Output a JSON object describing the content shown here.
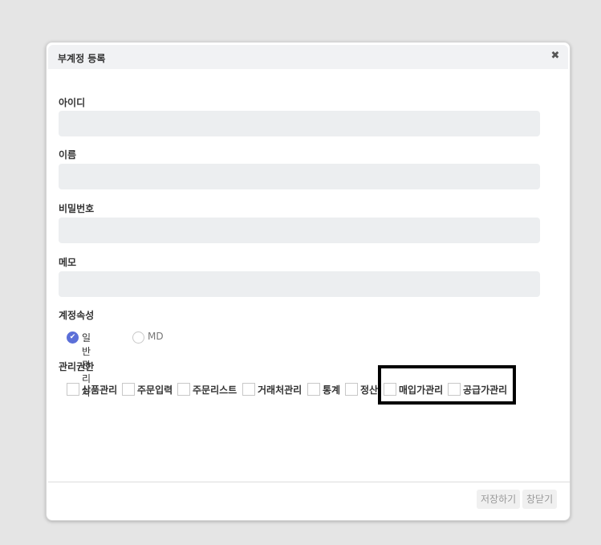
{
  "modal": {
    "title": "부계정 등록",
    "close_icon": "close-icon"
  },
  "fields": {
    "id": {
      "label": "아이디",
      "value": ""
    },
    "name": {
      "label": "이름",
      "value": ""
    },
    "password": {
      "label": "비밀번호",
      "value": ""
    },
    "memo": {
      "label": "메모",
      "value": ""
    }
  },
  "account_type": {
    "label": "계정속성",
    "options": [
      {
        "label": "일반관리자",
        "checked": true
      },
      {
        "label": "MD",
        "checked": false
      }
    ]
  },
  "permissions": {
    "label": "관리권한",
    "items": [
      {
        "label": "상품관리",
        "checked": false
      },
      {
        "label": "주문입력",
        "checked": false
      },
      {
        "label": "주문리스트",
        "checked": false
      },
      {
        "label": "거래처관리",
        "checked": false
      },
      {
        "label": "통계",
        "checked": false
      },
      {
        "label": "정산",
        "checked": false
      },
      {
        "label": "매입가관리",
        "checked": false
      },
      {
        "label": "공급가관리",
        "checked": false
      }
    ]
  },
  "footer": {
    "save_label": "저장하기",
    "close_label": "창닫기"
  },
  "colors": {
    "accent": "#5b6fd8",
    "input_bg": "#eceef0",
    "highlight": "#000000"
  }
}
